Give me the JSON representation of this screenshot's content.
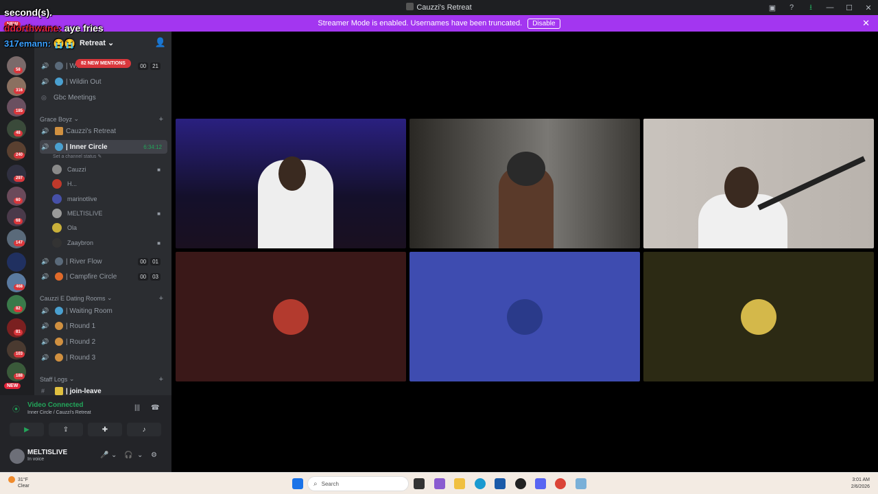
{
  "window": {
    "title": "Cauzzi's Retreat",
    "controls": {
      "minimize": "—",
      "maximize": "☐",
      "close": "✕"
    }
  },
  "banner": {
    "text": "Streamer Mode is enabled. Usernames have been truncated.",
    "disable_label": "Disable",
    "close": "✕"
  },
  "chat_overlay": {
    "line1": "second(s).",
    "line2_user": "ddorthwane:",
    "line2_msg": "aye fries",
    "line3": "317emann: 😭😭"
  },
  "new_tags": [
    "NEW",
    "NEW"
  ],
  "server_badges": [
    "58",
    "316",
    "185",
    "48",
    "240",
    "297",
    "60",
    "68",
    "147",
    "468",
    "82",
    "81",
    "103",
    "188"
  ],
  "server": {
    "name": "Retreat"
  },
  "mentions_pill": "82 NEW MENTIONS",
  "channels_top": [
    {
      "label": "| W...",
      "counts": [
        "00",
        "21"
      ]
    },
    {
      "label": "| Wildin Out"
    },
    {
      "label": "Gbc Meetings"
    }
  ],
  "categories": {
    "grace": "Grace Boyz",
    "dating": "Cauzzi E Dating Rooms",
    "staff": "Staff Logs"
  },
  "grace_channels": {
    "retreat": "Cauzzi's Retreat",
    "inner": "| Inner Circle",
    "inner_timer": "6:34:12",
    "status_note": "Set a channel status"
  },
  "voice_users": [
    {
      "name": "Cauzzi",
      "color": "#8a8a8a",
      "cam": true
    },
    {
      "name": "H...",
      "color": "#c0392b",
      "cam": false
    },
    {
      "name": "marinotlive",
      "color": "#4650a8",
      "cam": false
    },
    {
      "name": "MELTISLIVE",
      "color": "#9a9a9a",
      "cam": true
    },
    {
      "name": "Ola",
      "color": "#c9b03a",
      "cam": false
    },
    {
      "name": "Zaaybron",
      "color": "#333333",
      "cam": true
    }
  ],
  "more_channels": [
    {
      "label": "| River Flow",
      "counts": [
        "00",
        "01"
      ]
    },
    {
      "label": "| Campfire Circle",
      "counts": [
        "00",
        "03"
      ]
    }
  ],
  "dating_channels": [
    "| Waiting Room",
    "| Round 1",
    "| Round 2",
    "| Round 3"
  ],
  "staff_channel": "| join-leave",
  "voice_panel": {
    "status": "Video Connected",
    "sub": "Inner Circle / Cauzzi's Retreat"
  },
  "me": {
    "name": "MELTISLIVE",
    "sub": "In voice"
  },
  "tiles": [
    {
      "bg": "#14102b"
    },
    {
      "bg": "#2a2824"
    },
    {
      "bg": "#c9c3bd"
    },
    {
      "bg": "#3a1818",
      "avatar": "#b33a2e"
    },
    {
      "bg": "#3e4cb0",
      "avatar": "#2a3a8a"
    },
    {
      "bg": "#2c2a14",
      "avatar": "#d4b84a"
    }
  ],
  "taskbar": {
    "temp": "31°F",
    "weather": "Clear",
    "search": "Search",
    "time": "3:01 AM",
    "date": "2/6/2026"
  }
}
